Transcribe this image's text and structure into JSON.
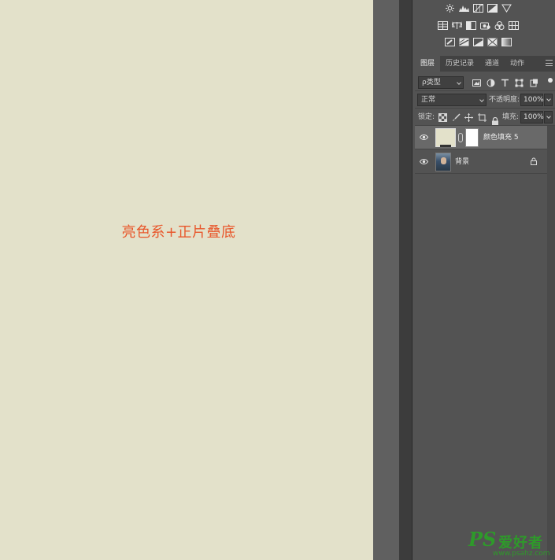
{
  "canvas": {
    "background": "#e3e1ca",
    "caption": "亮色系+正片叠底",
    "caption_color": "#e8572b"
  },
  "adjustments": {
    "rows": [
      [
        "brightness-icon",
        "levels-icon",
        "curves-icon",
        "exposure-icon",
        "vibrance-icon"
      ],
      [
        "hue-saturation-icon",
        "color-balance-icon",
        "black-white-icon",
        "photo-filter-icon",
        "channel-mixer-icon",
        "color-lookup-icon"
      ],
      [
        "invert-icon",
        "posterize-icon",
        "threshold-icon",
        "selective-color-icon",
        "gradient-map-icon"
      ]
    ]
  },
  "tabs": [
    {
      "label": "图层",
      "active": true
    },
    {
      "label": "历史记录",
      "active": false
    },
    {
      "label": "通道",
      "active": false
    },
    {
      "label": "动作",
      "active": false
    }
  ],
  "filter": {
    "kind_label": "ρ类型"
  },
  "blend": {
    "mode": "正常",
    "opacity_label": "不透明度:",
    "opacity_value": "100%"
  },
  "lock": {
    "label": "锁定:",
    "fill_label": "填充:",
    "fill_value": "100%"
  },
  "layers": [
    {
      "name": "颜色填充 5",
      "selected": true
    },
    {
      "name": "背景",
      "selected": false,
      "locked": true
    }
  ],
  "watermark": {
    "brand": "PS",
    "text": "爱好者",
    "url": "www.psahz.com",
    "color": "#2e9a2a"
  }
}
